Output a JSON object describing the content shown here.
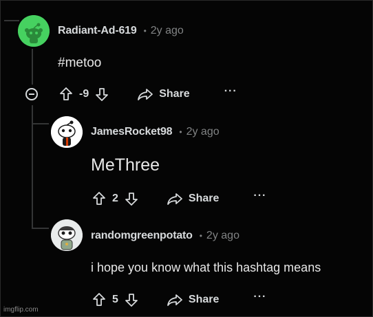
{
  "comments": [
    {
      "username": "Radiant-Ad-619",
      "separator": "•",
      "time": "2y ago",
      "body": "#metoo",
      "score": "-9",
      "share_label": "Share",
      "more_label": "···"
    },
    {
      "username": "JamesRocket98",
      "separator": "•",
      "time": "2y ago",
      "body": "MeThree",
      "score": "2",
      "share_label": "Share",
      "more_label": "···"
    },
    {
      "username": "randomgreenpotato",
      "separator": "•",
      "time": "2y ago",
      "body": "i hope you know what this hashtag means",
      "score": "5",
      "share_label": "Share",
      "more_label": "···"
    }
  ],
  "watermark": "imgflip.com",
  "colors": {
    "background": "#050505",
    "text": "#d7dadc",
    "muted": "#818384",
    "thread_line": "#343536",
    "avatar_green": "#46d160"
  },
  "icons": {
    "upvote": "arrow-up-icon",
    "downvote": "arrow-down-icon",
    "share": "share-arrow-icon",
    "collapse": "collapse-minus-icon"
  }
}
